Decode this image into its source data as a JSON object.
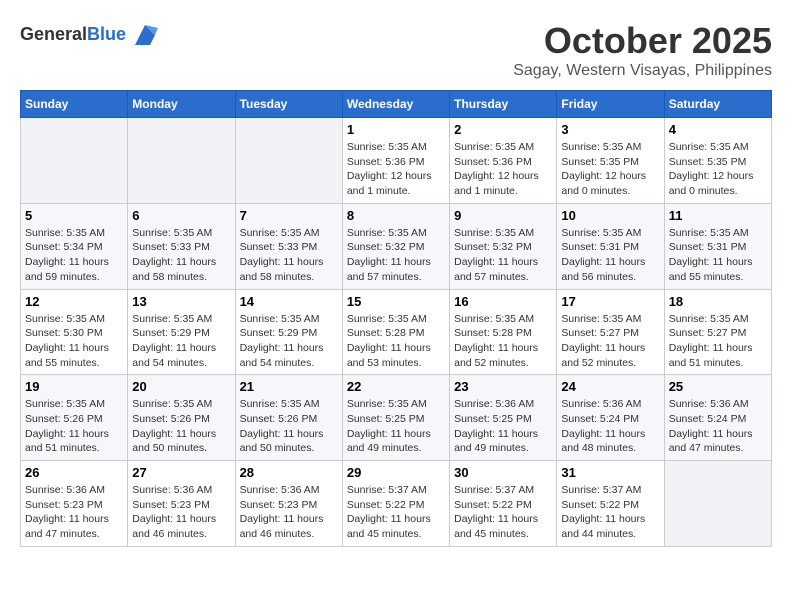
{
  "header": {
    "logo_general": "General",
    "logo_blue": "Blue",
    "month_title": "October 2025",
    "location": "Sagay, Western Visayas, Philippines"
  },
  "days_of_week": [
    "Sunday",
    "Monday",
    "Tuesday",
    "Wednesday",
    "Thursday",
    "Friday",
    "Saturday"
  ],
  "weeks": [
    [
      {
        "day": "",
        "sunrise": "",
        "sunset": "",
        "daylight": ""
      },
      {
        "day": "",
        "sunrise": "",
        "sunset": "",
        "daylight": ""
      },
      {
        "day": "",
        "sunrise": "",
        "sunset": "",
        "daylight": ""
      },
      {
        "day": "1",
        "sunrise": "Sunrise: 5:35 AM",
        "sunset": "Sunset: 5:36 PM",
        "daylight": "Daylight: 12 hours and 1 minute."
      },
      {
        "day": "2",
        "sunrise": "Sunrise: 5:35 AM",
        "sunset": "Sunset: 5:36 PM",
        "daylight": "Daylight: 12 hours and 1 minute."
      },
      {
        "day": "3",
        "sunrise": "Sunrise: 5:35 AM",
        "sunset": "Sunset: 5:35 PM",
        "daylight": "Daylight: 12 hours and 0 minutes."
      },
      {
        "day": "4",
        "sunrise": "Sunrise: 5:35 AM",
        "sunset": "Sunset: 5:35 PM",
        "daylight": "Daylight: 12 hours and 0 minutes."
      }
    ],
    [
      {
        "day": "5",
        "sunrise": "Sunrise: 5:35 AM",
        "sunset": "Sunset: 5:34 PM",
        "daylight": "Daylight: 11 hours and 59 minutes."
      },
      {
        "day": "6",
        "sunrise": "Sunrise: 5:35 AM",
        "sunset": "Sunset: 5:33 PM",
        "daylight": "Daylight: 11 hours and 58 minutes."
      },
      {
        "day": "7",
        "sunrise": "Sunrise: 5:35 AM",
        "sunset": "Sunset: 5:33 PM",
        "daylight": "Daylight: 11 hours and 58 minutes."
      },
      {
        "day": "8",
        "sunrise": "Sunrise: 5:35 AM",
        "sunset": "Sunset: 5:32 PM",
        "daylight": "Daylight: 11 hours and 57 minutes."
      },
      {
        "day": "9",
        "sunrise": "Sunrise: 5:35 AM",
        "sunset": "Sunset: 5:32 PM",
        "daylight": "Daylight: 11 hours and 57 minutes."
      },
      {
        "day": "10",
        "sunrise": "Sunrise: 5:35 AM",
        "sunset": "Sunset: 5:31 PM",
        "daylight": "Daylight: 11 hours and 56 minutes."
      },
      {
        "day": "11",
        "sunrise": "Sunrise: 5:35 AM",
        "sunset": "Sunset: 5:31 PM",
        "daylight": "Daylight: 11 hours and 55 minutes."
      }
    ],
    [
      {
        "day": "12",
        "sunrise": "Sunrise: 5:35 AM",
        "sunset": "Sunset: 5:30 PM",
        "daylight": "Daylight: 11 hours and 55 minutes."
      },
      {
        "day": "13",
        "sunrise": "Sunrise: 5:35 AM",
        "sunset": "Sunset: 5:29 PM",
        "daylight": "Daylight: 11 hours and 54 minutes."
      },
      {
        "day": "14",
        "sunrise": "Sunrise: 5:35 AM",
        "sunset": "Sunset: 5:29 PM",
        "daylight": "Daylight: 11 hours and 54 minutes."
      },
      {
        "day": "15",
        "sunrise": "Sunrise: 5:35 AM",
        "sunset": "Sunset: 5:28 PM",
        "daylight": "Daylight: 11 hours and 53 minutes."
      },
      {
        "day": "16",
        "sunrise": "Sunrise: 5:35 AM",
        "sunset": "Sunset: 5:28 PM",
        "daylight": "Daylight: 11 hours and 52 minutes."
      },
      {
        "day": "17",
        "sunrise": "Sunrise: 5:35 AM",
        "sunset": "Sunset: 5:27 PM",
        "daylight": "Daylight: 11 hours and 52 minutes."
      },
      {
        "day": "18",
        "sunrise": "Sunrise: 5:35 AM",
        "sunset": "Sunset: 5:27 PM",
        "daylight": "Daylight: 11 hours and 51 minutes."
      }
    ],
    [
      {
        "day": "19",
        "sunrise": "Sunrise: 5:35 AM",
        "sunset": "Sunset: 5:26 PM",
        "daylight": "Daylight: 11 hours and 51 minutes."
      },
      {
        "day": "20",
        "sunrise": "Sunrise: 5:35 AM",
        "sunset": "Sunset: 5:26 PM",
        "daylight": "Daylight: 11 hours and 50 minutes."
      },
      {
        "day": "21",
        "sunrise": "Sunrise: 5:35 AM",
        "sunset": "Sunset: 5:26 PM",
        "daylight": "Daylight: 11 hours and 50 minutes."
      },
      {
        "day": "22",
        "sunrise": "Sunrise: 5:35 AM",
        "sunset": "Sunset: 5:25 PM",
        "daylight": "Daylight: 11 hours and 49 minutes."
      },
      {
        "day": "23",
        "sunrise": "Sunrise: 5:36 AM",
        "sunset": "Sunset: 5:25 PM",
        "daylight": "Daylight: 11 hours and 49 minutes."
      },
      {
        "day": "24",
        "sunrise": "Sunrise: 5:36 AM",
        "sunset": "Sunset: 5:24 PM",
        "daylight": "Daylight: 11 hours and 48 minutes."
      },
      {
        "day": "25",
        "sunrise": "Sunrise: 5:36 AM",
        "sunset": "Sunset: 5:24 PM",
        "daylight": "Daylight: 11 hours and 47 minutes."
      }
    ],
    [
      {
        "day": "26",
        "sunrise": "Sunrise: 5:36 AM",
        "sunset": "Sunset: 5:23 PM",
        "daylight": "Daylight: 11 hours and 47 minutes."
      },
      {
        "day": "27",
        "sunrise": "Sunrise: 5:36 AM",
        "sunset": "Sunset: 5:23 PM",
        "daylight": "Daylight: 11 hours and 46 minutes."
      },
      {
        "day": "28",
        "sunrise": "Sunrise: 5:36 AM",
        "sunset": "Sunset: 5:23 PM",
        "daylight": "Daylight: 11 hours and 46 minutes."
      },
      {
        "day": "29",
        "sunrise": "Sunrise: 5:37 AM",
        "sunset": "Sunset: 5:22 PM",
        "daylight": "Daylight: 11 hours and 45 minutes."
      },
      {
        "day": "30",
        "sunrise": "Sunrise: 5:37 AM",
        "sunset": "Sunset: 5:22 PM",
        "daylight": "Daylight: 11 hours and 45 minutes."
      },
      {
        "day": "31",
        "sunrise": "Sunrise: 5:37 AM",
        "sunset": "Sunset: 5:22 PM",
        "daylight": "Daylight: 11 hours and 44 minutes."
      },
      {
        "day": "",
        "sunrise": "",
        "sunset": "",
        "daylight": ""
      }
    ]
  ]
}
